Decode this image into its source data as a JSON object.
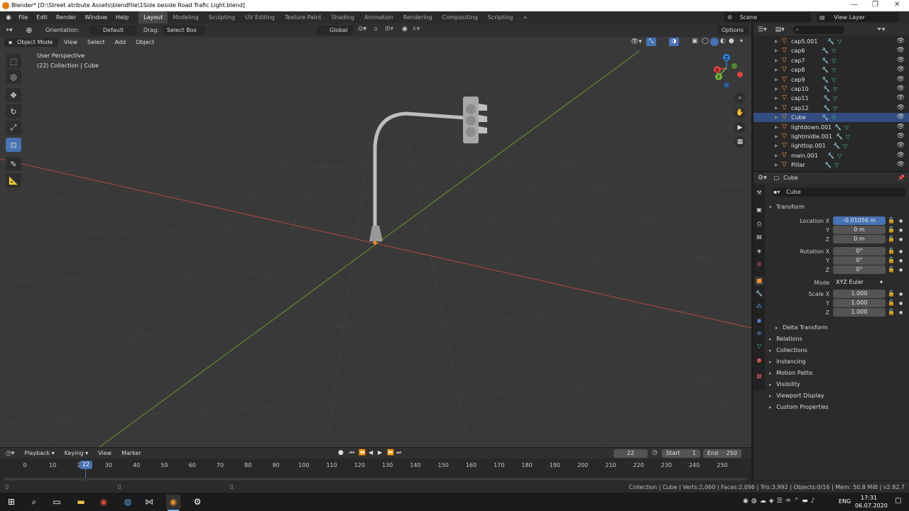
{
  "titlebar": {
    "title": "Blender* [D:\\Street atribute Assets\\blendFile\\1Side beside Road Trafic Light.blend]",
    "minimize": "—",
    "restore": "❐",
    "close": "✕"
  },
  "menu": {
    "items": [
      "File",
      "Edit",
      "Render",
      "Window",
      "Help"
    ],
    "workspaces": [
      "Layout",
      "Modeling",
      "Sculpting",
      "UV Editing",
      "Texture Paint",
      "Shading",
      "Animation",
      "Rendering",
      "Compositing",
      "Scripting"
    ],
    "active_workspace": "Layout",
    "add_workspace": "+",
    "scene_label": "Scene",
    "view_layer_label": "View Layer"
  },
  "toolheader": {
    "orientation_label": "Orientation:",
    "orientation_value": "Default",
    "drag_label": "Drag:",
    "drag_value": "Select Box",
    "transform_orientation": "Global",
    "options": "Options"
  },
  "viewport": {
    "mode": "Object Mode",
    "menus": [
      "View",
      "Select",
      "Add",
      "Object"
    ],
    "overlay_line1": "User Perspective",
    "overlay_line2": "(22) Collection | Cube",
    "gizmo": {
      "x": "X",
      "y": "Y",
      "z": "Z"
    }
  },
  "outliner": {
    "search_placeholder": "",
    "rows": [
      {
        "name": "cap5.001",
        "selected": false
      },
      {
        "name": "cap6",
        "selected": false
      },
      {
        "name": "cap7",
        "selected": false
      },
      {
        "name": "cap8",
        "selected": false
      },
      {
        "name": "cap9",
        "selected": false
      },
      {
        "name": "cap10",
        "selected": false
      },
      {
        "name": "cap11",
        "selected": false
      },
      {
        "name": "cap12",
        "selected": false
      },
      {
        "name": "Cube",
        "selected": true
      },
      {
        "name": "lightdown.001",
        "selected": false
      },
      {
        "name": "lightmidle.001",
        "selected": false
      },
      {
        "name": "lighttop.001",
        "selected": false
      },
      {
        "name": "main.001",
        "selected": false
      },
      {
        "name": "Pillar",
        "selected": false
      }
    ]
  },
  "properties": {
    "header_object": "Cube",
    "object_name": "Cube",
    "transform_title": "Transform",
    "location_label": "Location X",
    "location": [
      "-0.01056 m",
      "0 m",
      "0 m"
    ],
    "rotation_label": "Rotation X",
    "rotation": [
      "0°",
      "0°",
      "0°"
    ],
    "mode_label": "Mode",
    "mode_value": "XYZ Euler",
    "scale_label": "Scale X",
    "scale": [
      "1.000",
      "1.000",
      "1.000"
    ],
    "axis_y": "Y",
    "axis_z": "Z",
    "delta_transform": "Delta Transform",
    "panels": [
      "Relations",
      "Collections",
      "Instancing",
      "Motion Paths",
      "Visibility",
      "Viewport Display",
      "Custom Properties"
    ]
  },
  "timeline": {
    "menus": [
      "Playback",
      "Keying",
      "View",
      "Marker"
    ],
    "current_frame": "22",
    "start_label": "Start",
    "start_value": "1",
    "end_label": "End",
    "end_value": "250",
    "ticks": [
      "0",
      "10",
      "20",
      "30",
      "40",
      "50",
      "60",
      "70",
      "80",
      "90",
      "100",
      "110",
      "120",
      "130",
      "140",
      "150",
      "160",
      "170",
      "180",
      "190",
      "200",
      "210",
      "220",
      "230",
      "240",
      "250"
    ],
    "playhead_label": "22"
  },
  "statusbar": {
    "stats": "Collection | Cube | Verts:2,060 | Faces:2,096 | Tris:3,992 | Objects:0/16 | Mem: 50.8 MiB | v2.82.7"
  },
  "taskbar": {
    "lang": "ENG",
    "time": "17:31",
    "date": "06.07.2020"
  },
  "colors": {
    "accent": "#4772b3",
    "x_axis": "#c04040",
    "y_axis": "#6a9a2a"
  }
}
